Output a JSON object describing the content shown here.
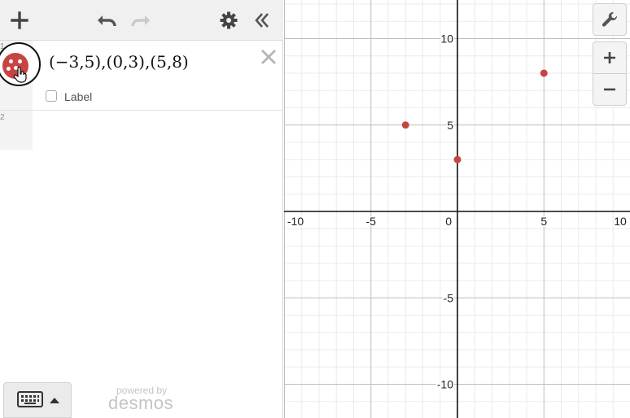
{
  "toolbar": {
    "icons": [
      "plus-icon",
      "undo-icon",
      "redo-icon",
      "gear-icon",
      "collapse-icon"
    ]
  },
  "expressions": [
    {
      "index": "1",
      "latex": "(−3,5),(0,3),(5,8)",
      "label_option": "Label",
      "label_checked": false,
      "color": "#c74440"
    },
    {
      "index": "2",
      "latex": ""
    }
  ],
  "footer": {
    "keyboard_icon": "keyboard-icon",
    "powered_by": "powered by",
    "brand": "desmos"
  },
  "graph_controls": {
    "icons": [
      "wrench-icon",
      "zoom-in-icon",
      "zoom-out-icon"
    ]
  },
  "colors": {
    "point": "#c74440",
    "toolbar_bg": "#f0f0f0",
    "axis": "#111111",
    "major_grid": "#bdbdbd",
    "minor_grid": "#ebebeb"
  },
  "chart_data": {
    "type": "scatter",
    "x": [
      -3,
      0,
      5
    ],
    "y": [
      5,
      3,
      8
    ],
    "xlim": [
      -10,
      10
    ],
    "ylim": [
      -12,
      12
    ],
    "x_ticks": [
      "-10",
      "-5",
      "0",
      "5",
      "10"
    ],
    "y_ticks": [
      "10",
      "5",
      "-5",
      "-10"
    ],
    "grid": true
  }
}
